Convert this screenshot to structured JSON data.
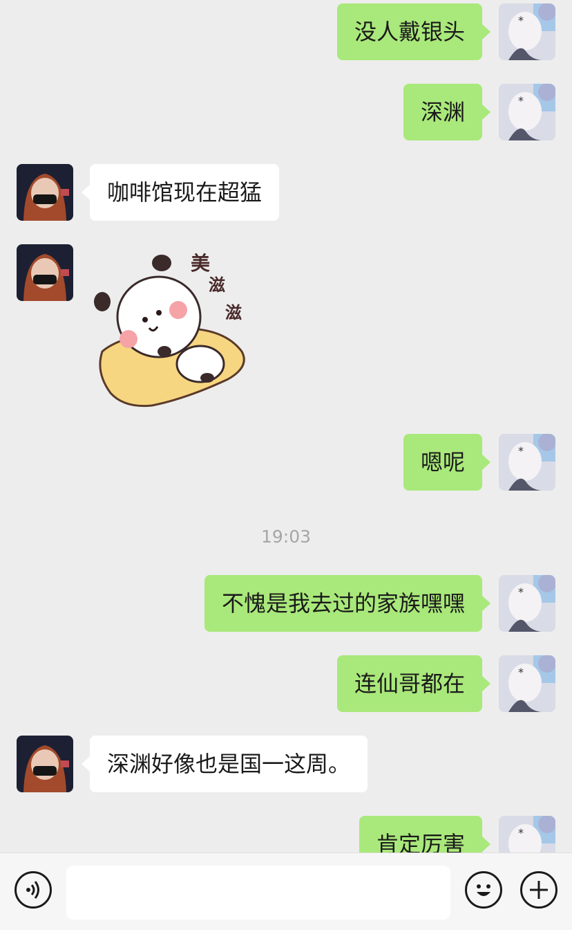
{
  "messages": [
    {
      "side": "me",
      "text": "没人戴银头"
    },
    {
      "side": "me",
      "text": "深渊"
    },
    {
      "side": "them",
      "text": "咖啡馆现在超猛"
    },
    {
      "side": "them",
      "type": "sticker",
      "sticker_text": [
        "美",
        "滋",
        "滋"
      ]
    },
    {
      "side": "me",
      "text": "嗯呢"
    },
    {
      "type": "timestamp",
      "text": "19:03"
    },
    {
      "side": "me",
      "text": "不愧是我去过的家族嘿嘿"
    },
    {
      "side": "me",
      "text": "连仙哥都在"
    },
    {
      "side": "them",
      "text": "深渊好像也是国一这周。"
    },
    {
      "side": "me",
      "text": "肯定厉害"
    }
  ],
  "colors": {
    "background": "#ededed",
    "my_bubble": "#a9e87a",
    "their_bubble": "#ffffff",
    "timestamp_text": "#a6a6a6"
  },
  "input_bar": {
    "voice_icon": "voice-icon",
    "emoji_icon": "emoji-icon",
    "add_icon": "plus-icon",
    "text_value": ""
  }
}
